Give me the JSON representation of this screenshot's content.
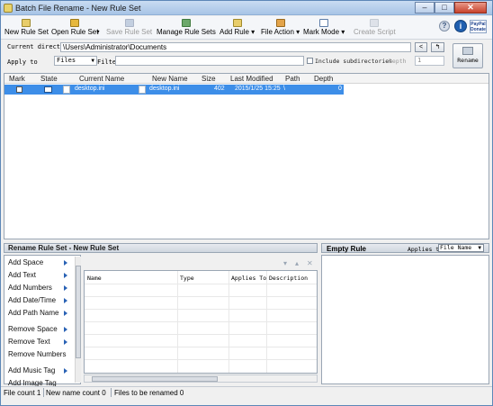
{
  "window": {
    "title": "Batch File Rename - New Rule Set"
  },
  "toolbar": {
    "new_rule_set": "New Rule Set",
    "open_rule_set": "Open Rule Set",
    "save_rule_set": "Save Rule Set",
    "manage_rule_sets": "Manage Rule Sets",
    "add_rule": "Add Rule",
    "file_action": "File Action",
    "mark_mode": "Mark Mode",
    "create_script": "Create Script",
    "paypal": "PayPal Donate"
  },
  "directory": {
    "label": "Current directory",
    "value": "\\Users\\Administrator\\Documents",
    "apply_to_label": "Apply to",
    "apply_to_value": "Files",
    "filter_label": "Filter",
    "filter_value": "",
    "include_subdirs_label": "Include subdirectories",
    "depth_label": "Depth",
    "depth_value": "1",
    "rename_button": "Rename"
  },
  "file_list": {
    "columns": [
      "Mark",
      "State",
      "Current Name",
      "New Name",
      "Size",
      "Last Modified",
      "Path",
      "Depth"
    ],
    "rows": [
      {
        "current_name": "desktop.ini",
        "new_name": "desktop.ini",
        "size": "402",
        "last_modified": "2015/1/25 15:25",
        "path": "\\",
        "depth": "0"
      }
    ]
  },
  "rule_set_panel": {
    "title": "Rename Rule Set - New Rule Set"
  },
  "rule_categories": [
    "Add Space",
    "Add Text",
    "Add Numbers",
    "Add Date/Time",
    "Add Path Name",
    "Remove Space",
    "Remove Text",
    "Remove Numbers",
    "Add Music Tag",
    "Add Image Tag"
  ],
  "rules_table": {
    "columns": [
      "Name",
      "Type",
      "Applies To",
      "Description"
    ]
  },
  "empty_rule_panel": {
    "title": "Empty Rule",
    "applies_to_label": "Applies to",
    "applies_to_value": "File Name"
  },
  "status": {
    "file_count": "File count  1",
    "new_name_count": "New name count  0",
    "files_to_rename": "Files to be renamed  0"
  }
}
